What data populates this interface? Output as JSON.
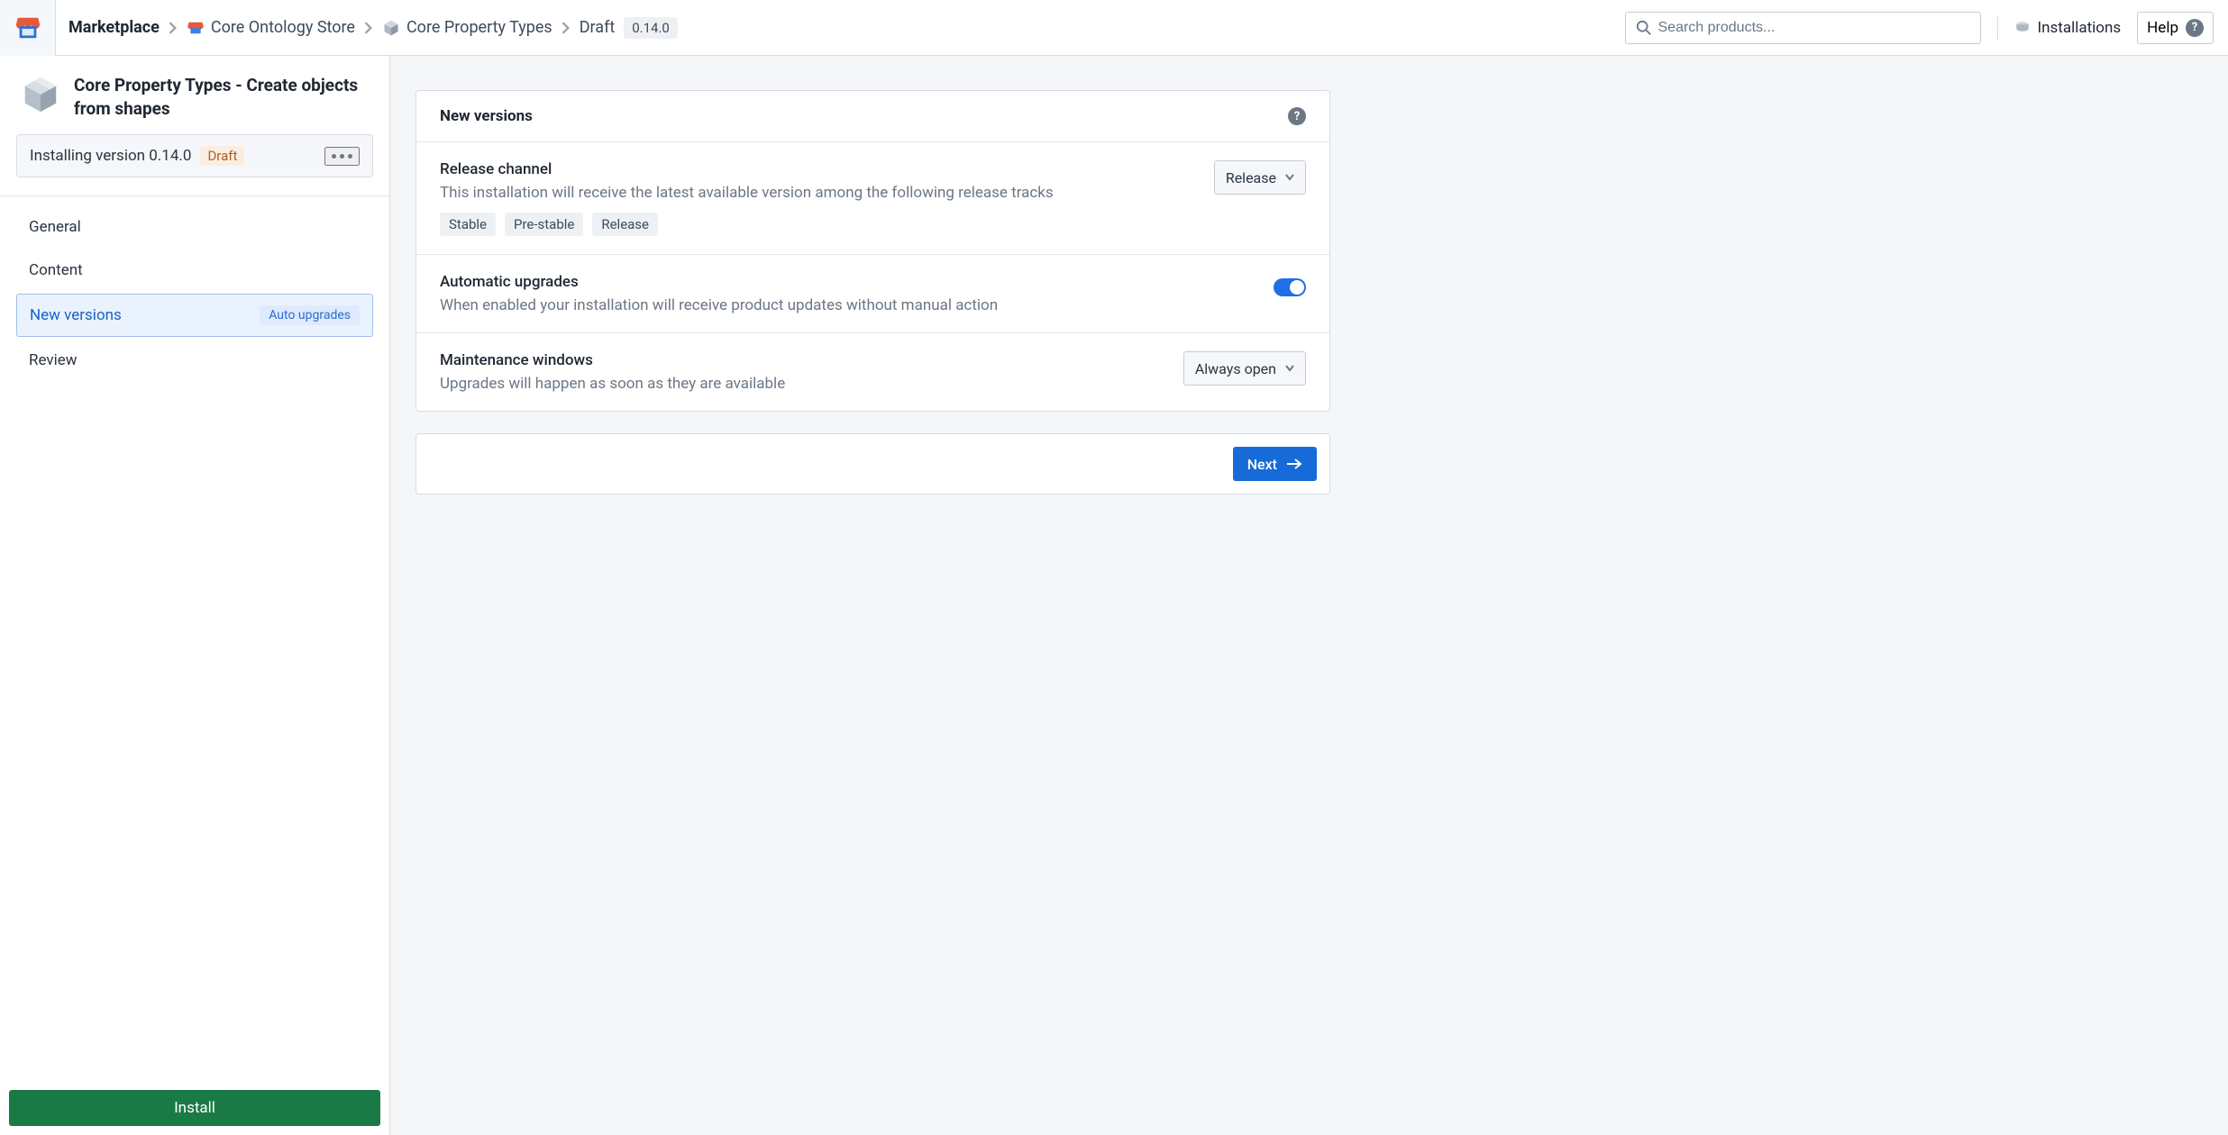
{
  "topbar": {
    "root": "Marketplace",
    "crumbs": [
      {
        "label": "Core Ontology Store"
      },
      {
        "label": "Core Property Types"
      },
      {
        "label": "Draft"
      }
    ],
    "version_pill": "0.14.0",
    "search_placeholder": "Search products...",
    "installations_label": "Installations",
    "help_label": "Help"
  },
  "sidebar": {
    "title": "Core Property Types - Create objects from shapes",
    "install_status": "Installing version 0.14.0",
    "status_tag": "Draft",
    "nav": [
      {
        "label": "General"
      },
      {
        "label": "Content"
      },
      {
        "label": "New versions",
        "badge": "Auto upgrades",
        "active": true
      },
      {
        "label": "Review"
      }
    ],
    "install_button": "Install"
  },
  "panel": {
    "title": "New versions",
    "sections": {
      "release": {
        "title": "Release channel",
        "desc": "This installation will receive the latest available version among the following release tracks",
        "chips": [
          "Stable",
          "Pre-stable",
          "Release"
        ],
        "select": "Release"
      },
      "auto": {
        "title": "Automatic upgrades",
        "desc": "When enabled your installation will receive product updates without manual action"
      },
      "maint": {
        "title": "Maintenance windows",
        "desc": "Upgrades will happen as soon as they are available",
        "select": "Always open"
      }
    },
    "next": "Next"
  }
}
